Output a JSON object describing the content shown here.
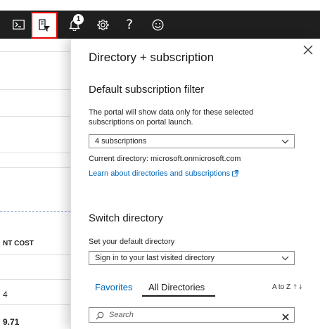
{
  "topbar": {
    "notification_count": "1",
    "help_glyph": "?",
    "icons": [
      "cloud-shell-icon",
      "directory-filter-icon",
      "bell-icon",
      "gear-icon",
      "help-icon",
      "feedback-smiley-icon"
    ],
    "highlight_color": "#e50000"
  },
  "background": {
    "column_header": "NT COST",
    "values": [
      "4",
      "9.71"
    ]
  },
  "panel": {
    "title": "Directory + subscription",
    "filter_heading": "Default subscription filter",
    "filter_description": "The portal will show data only for these selected subscriptions on portal launch.",
    "subscriptions_select": "4 subscriptions",
    "current_directory": "Current directory: microsoft.onmicrosoft.com",
    "learn_link": "Learn about directories and subscriptions",
    "switch_heading": "Switch directory",
    "default_dir_label": "Set your default directory",
    "default_dir_select": "Sign in to your last visited directory",
    "tabs": [
      {
        "label": "Favorites",
        "active": false
      },
      {
        "label": "All Directories",
        "active": true
      }
    ],
    "sort_label": "A to Z",
    "sort_glyph": "↑↓",
    "search_placeholder": "Search",
    "link_color": "#0067b8"
  }
}
